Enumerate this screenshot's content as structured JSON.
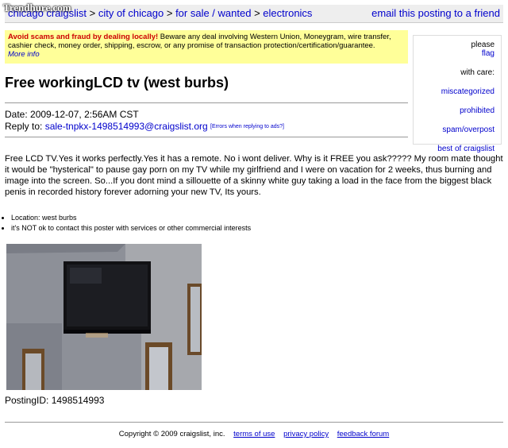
{
  "watermark": "Trendhure.com",
  "breadcrumb": {
    "site": "chicago craigslist",
    "sep": ">",
    "city": "city of chicago",
    "section": "for sale / wanted",
    "category": "electronics",
    "email_link": "email this posting to a friend"
  },
  "warning": {
    "strong": "Avoid scams and fraud by dealing locally!",
    "text": " Beware any deal involving Western Union, Moneygram, wire transfer, cashier check, money order, shipping, escrow, or any promise of transaction protection/certification/guarantee.",
    "more": "More info"
  },
  "flag": {
    "lead_prefix": "please ",
    "lead_link": "flag",
    "lead_suffix": " with care:",
    "items": [
      "miscategorized",
      "prohibited",
      "spam/overpost",
      "best of craigslist"
    ]
  },
  "post": {
    "title": "Free workingLCD tv (west burbs)",
    "date_label": "Date: 2009-12-07, 2:56AM CST",
    "reply_label": "Reply to: ",
    "reply_email": "sale-tnpkx-1498514993@craigslist.org",
    "reply_errors": "[Errors when replying to ads?]",
    "body": "Free LCD TV.Yes it works perfectly.Yes it has a remote. No i wont deliver. Why is it FREE you ask????? My room mate thought it would be \"hysterical\" to pause gay porn on my TV while my girlfriend and I were on vacation for 2 weeks, thus burning and image into the screen. So...If you dont mind a sillouette of a skinny white guy taking a load in the face from the biggest black penis in recorded history forever adorning your new TV, Its yours.",
    "attrs": [
      "Location: west burbs",
      "it's NOT ok to contact this poster with services or other commercial interests"
    ],
    "posting_id": "PostingID: 1498514993"
  },
  "footer": {
    "copyright": "Copyright © 2009 craigslist, inc.",
    "terms": "terms of use",
    "privacy": "privacy policy",
    "feedback": "feedback forum"
  }
}
